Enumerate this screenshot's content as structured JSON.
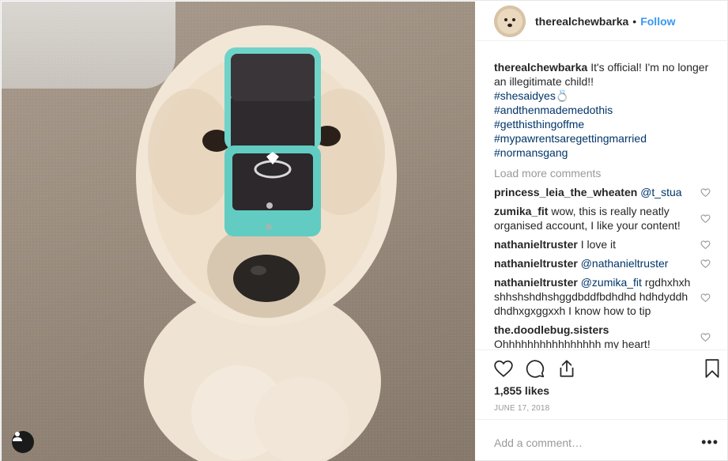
{
  "post": {
    "username": "therealchewbarka",
    "dot": "•",
    "follow_label": "Follow",
    "caption": {
      "username": "therealchewbarka",
      "text": "It's official! I'm no longer an illegitimate child!!",
      "hashtags": [
        "#shesaidyes💍",
        "#andthenmademedothis",
        "#getthisthingoffme",
        "#mypawrentsaregettingmarried",
        "#normansgang"
      ]
    },
    "load_more_label": "Load more comments",
    "comments": [
      {
        "username": "princess_leia_the_wheaten",
        "mention": "@t_stua",
        "text": ""
      },
      {
        "username": "zumika_fit",
        "mention": "",
        "text": "wow, this is really neatly organised account, I like your content!"
      },
      {
        "username": "nathanieltruster",
        "mention": "",
        "text": "I love it"
      },
      {
        "username": "nathanieltruster",
        "mention": "@nathanieltruster",
        "text": ""
      },
      {
        "username": "nathanieltruster",
        "mention": "@zumika_fit",
        "text": "rgdhxhxhshhshshdhshggdbddfbdhdhd hdhdyddhdhdhxgxggxxh I know how to tip"
      },
      {
        "username": "the.doodlebug.sisters",
        "mention": "",
        "text": "Ohhhhhhhhhhhhhhhh my heart!"
      }
    ],
    "likes": "1,855 likes",
    "date": "June 17, 2018",
    "add_comment_placeholder": "Add a comment…",
    "more_label": "•••",
    "icons": {
      "like": "heart-icon",
      "comment": "comment-icon",
      "share": "share-icon",
      "save": "bookmark-icon",
      "user_tag": "user-icon"
    },
    "colors": {
      "link": "#3897f0",
      "hashtag": "#003569",
      "muted": "#999999",
      "ring_box": "#5fcfc6"
    }
  }
}
